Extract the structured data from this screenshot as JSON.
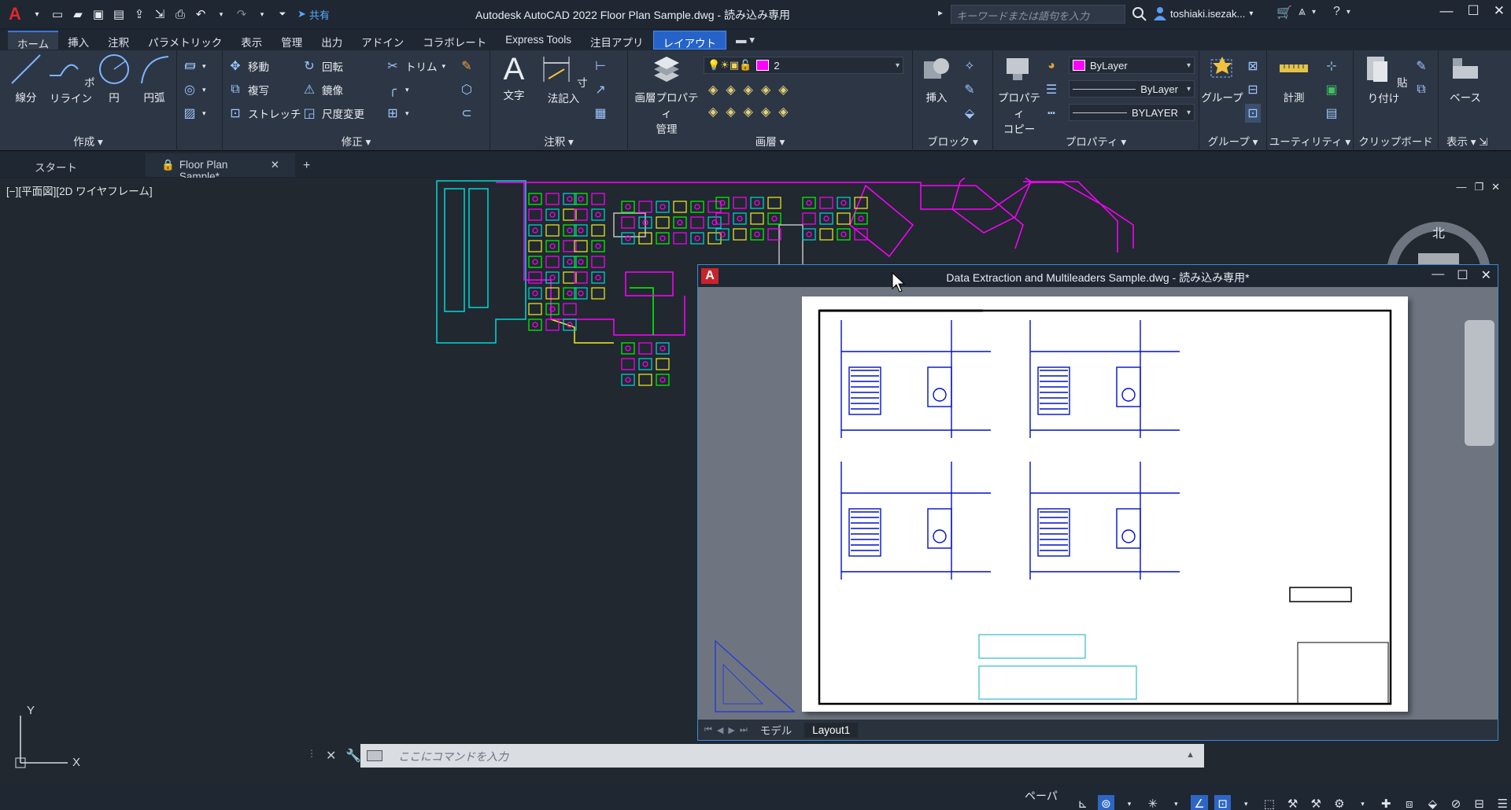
{
  "titlebar": {
    "app_title": "Autodesk AutoCAD 2022    Floor Plan Sample.dwg - 読み込み専用",
    "share_label": "共有",
    "search_placeholder": "キーワードまたは語句を入力",
    "user_name": "toshiaki.isezak...",
    "icons": [
      "autocad-logo-icon",
      "new-icon",
      "open-icon",
      "save-icon",
      "save-as-icon",
      "upload-icon",
      "import-icon",
      "print-icon",
      "undo-icon",
      "redo-icon",
      "share-icon"
    ]
  },
  "ribbon_tabs": [
    {
      "label": "ホーム",
      "state": "home"
    },
    {
      "label": "挿入"
    },
    {
      "label": "注釈"
    },
    {
      "label": "パラメトリック"
    },
    {
      "label": "表示"
    },
    {
      "label": "管理"
    },
    {
      "label": "出力"
    },
    {
      "label": "アドイン"
    },
    {
      "label": "コラボレート"
    },
    {
      "label": "Express Tools"
    },
    {
      "label": "注目アプリ"
    },
    {
      "label": "レイアウト",
      "state": "active"
    }
  ],
  "ribbon": {
    "draw": {
      "title": "作成",
      "line": "線分",
      "polyline": "ポリライン",
      "circle": "円",
      "arc": "円弧"
    },
    "modify": {
      "title": "修正",
      "move": "移動",
      "rotate": "回転",
      "trim": "トリム",
      "copy": "複写",
      "mirror": "鏡像",
      "stretch": "ストレッチ",
      "scale": "尺度変更"
    },
    "annotation": {
      "title": "注釈",
      "text": "文字",
      "dimension": "寸法記入"
    },
    "layers": {
      "title": "画層",
      "props": "画層プロパティ",
      "props2": "管理",
      "current_layer": "2"
    },
    "block": {
      "title": "ブロック",
      "insert": "挿入"
    },
    "properties": {
      "title": "プロパティ",
      "match": "プロパティ",
      "match2": "コピー",
      "color": "ByLayer",
      "linetype": "ByLayer",
      "lineweight": "BYLAYER"
    },
    "groups": {
      "title": "グループ",
      "group": "グループ"
    },
    "utilities": {
      "title": "ユーティリティ",
      "measure": "計測"
    },
    "clipboard": {
      "title": "クリップボード",
      "paste": "貼り付け"
    },
    "view": {
      "title": "表示",
      "base": "ベース"
    }
  },
  "doc_tabs": {
    "start": "スタート",
    "current": "Floor Plan Sample*"
  },
  "viewport": {
    "label": "[−][平面図][2D ワイヤフレーム]",
    "north": "北"
  },
  "float_window": {
    "title": "Data Extraction and Multileaders Sample.dwg - 読み込み専用*",
    "tab_model": "モデル",
    "tab_layout": "Layout1"
  },
  "command": {
    "placeholder": "ここにコマンドを入力"
  },
  "status": {
    "paper": "ペーパー"
  },
  "colors": {
    "accent": "#2563c8",
    "layer_color": "#ff00ff"
  }
}
